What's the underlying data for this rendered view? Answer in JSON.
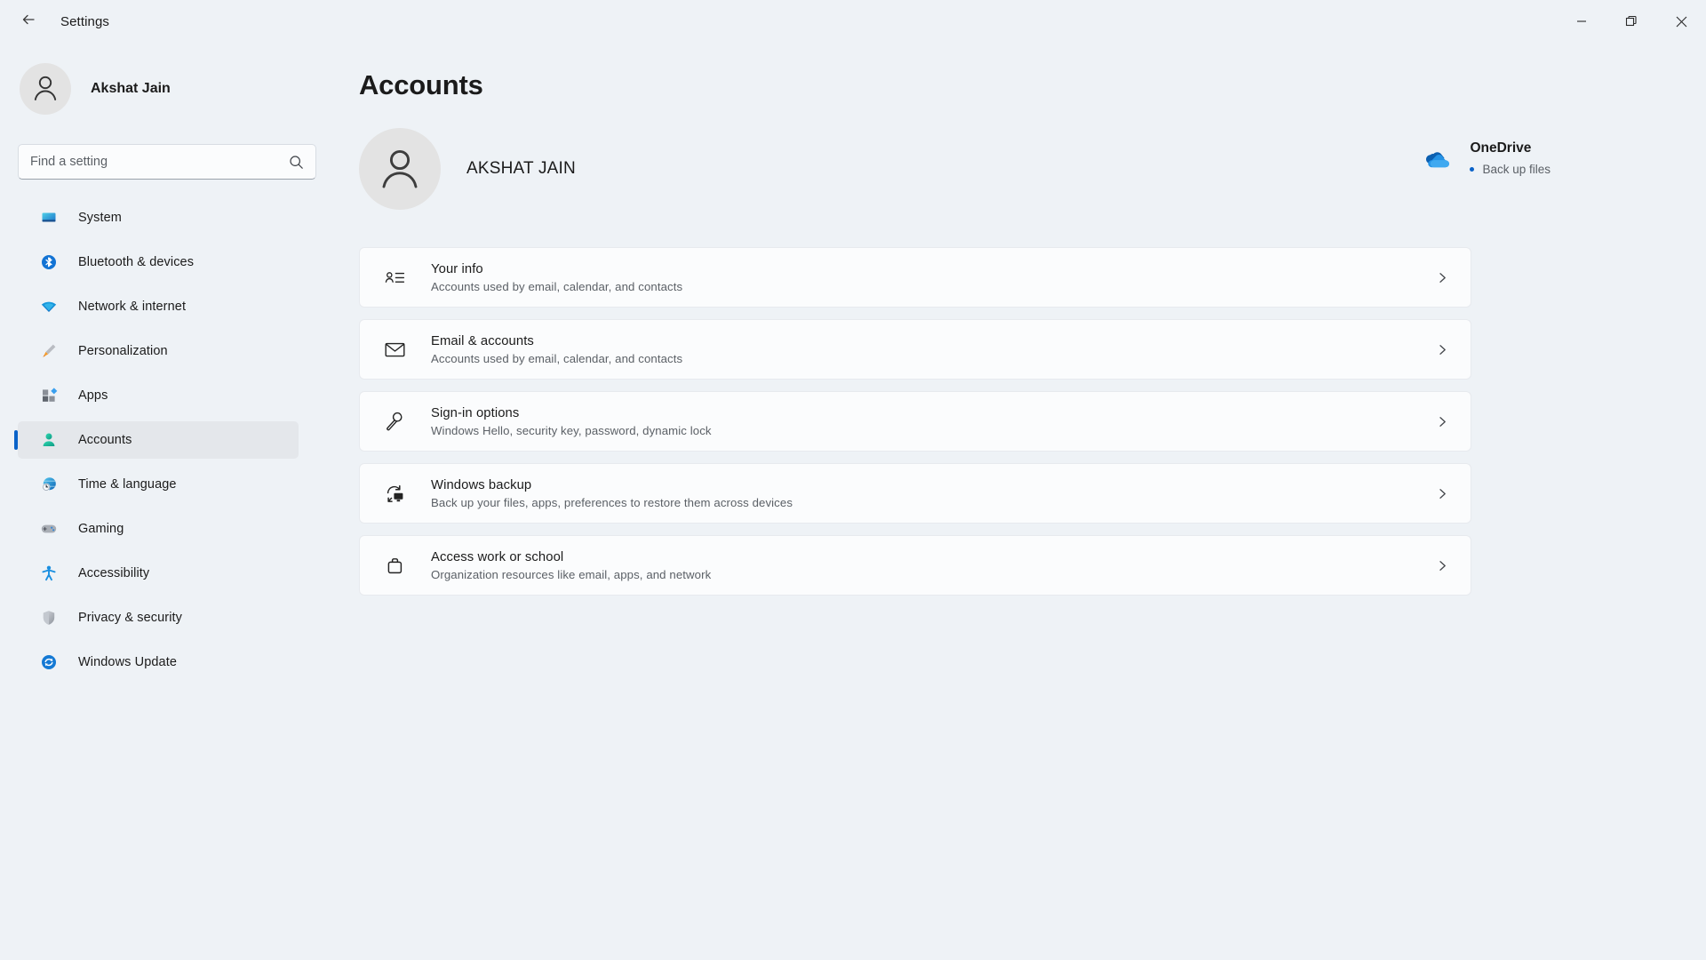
{
  "window": {
    "title": "Settings",
    "back_icon": "back-arrow-icon",
    "controls": [
      {
        "name": "minimize-button",
        "icon": "minimize-icon"
      },
      {
        "name": "maximize-button",
        "icon": "restore-icon"
      },
      {
        "name": "close-button",
        "icon": "close-icon"
      }
    ]
  },
  "sidebar": {
    "profile": {
      "name": "Akshat Jain",
      "avatar_icon": "user-avatar-icon"
    },
    "search": {
      "placeholder": "Find a setting",
      "value": "",
      "icon": "search-icon"
    },
    "items": [
      {
        "label": "System",
        "icon": "monitor-icon",
        "selected": false
      },
      {
        "label": "Bluetooth & devices",
        "icon": "bluetooth-icon",
        "selected": false
      },
      {
        "label": "Network & internet",
        "icon": "wifi-icon",
        "selected": false
      },
      {
        "label": "Personalization",
        "icon": "paintbrush-icon",
        "selected": false
      },
      {
        "label": "Apps",
        "icon": "apps-grid-icon",
        "selected": false
      },
      {
        "label": "Accounts",
        "icon": "person-icon",
        "selected": true
      },
      {
        "label": "Time & language",
        "icon": "globe-clock-icon",
        "selected": false
      },
      {
        "label": "Gaming",
        "icon": "gamepad-icon",
        "selected": false
      },
      {
        "label": "Accessibility",
        "icon": "accessibility-icon",
        "selected": false
      },
      {
        "label": "Privacy & security",
        "icon": "shield-icon",
        "selected": false
      },
      {
        "label": "Windows Update",
        "icon": "update-refresh-icon",
        "selected": false
      }
    ]
  },
  "main": {
    "page_title": "Accounts",
    "account": {
      "display_name": "AKSHAT JAIN",
      "avatar_icon": "user-avatar-icon"
    },
    "onedrive": {
      "title": "OneDrive",
      "status": "Back up files",
      "icon": "onedrive-cloud-icon",
      "dot_color": "#0a62c8"
    },
    "cards": [
      {
        "title": "Your info",
        "subtitle": "Accounts used by email, calendar, and contacts",
        "icon": "contact-info-icon",
        "chevron": "chevron-right-icon"
      },
      {
        "title": "Email & accounts",
        "subtitle": "Accounts used by email, calendar, and contacts",
        "icon": "envelope-icon",
        "chevron": "chevron-right-icon"
      },
      {
        "title": "Sign-in options",
        "subtitle": "Windows Hello, security key, password, dynamic lock",
        "icon": "key-icon",
        "chevron": "chevron-right-icon"
      },
      {
        "title": "Windows backup",
        "subtitle": "Back up your files, apps, preferences to restore them across devices",
        "icon": "backup-restore-icon",
        "chevron": "chevron-right-icon"
      },
      {
        "title": "Access work or school",
        "subtitle": "Organization resources like email, apps, and network",
        "icon": "briefcase-icon",
        "chevron": "chevron-right-icon"
      }
    ]
  },
  "colors": {
    "app_background": "#eef2f6",
    "card_background": "#fbfcfd",
    "selection_background": "#e4e7eb",
    "accent": "#0a62c8",
    "text_primary": "#1b1b1b",
    "text_secondary": "#5b6066"
  }
}
